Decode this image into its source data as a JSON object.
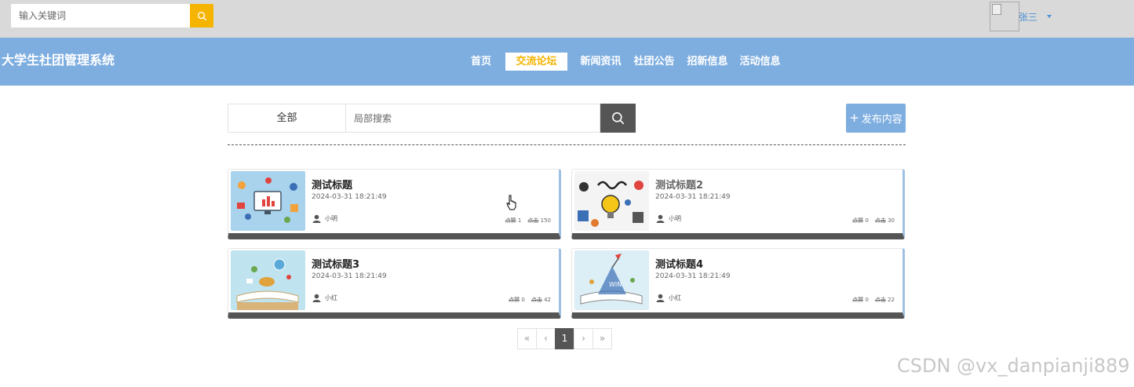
{
  "topbar": {
    "search_placeholder": "输入关键词",
    "username": "张三"
  },
  "navbar": {
    "site_title": "大学生社团管理系统",
    "items": [
      {
        "label": "首页"
      },
      {
        "label": "交流论坛",
        "active": true
      },
      {
        "label": "新闻资讯"
      },
      {
        "label": "社团公告"
      },
      {
        "label": "招新信息"
      },
      {
        "label": "活动信息"
      }
    ]
  },
  "toolbar": {
    "filter_label": "全部",
    "search_placeholder": "局部搜索",
    "publish_label": "发布内容"
  },
  "posts": [
    {
      "title": "测试标题",
      "time": "2024-03-31 18:21:49",
      "author": "小明",
      "likes_label": "点赞",
      "likes": "1",
      "clicks_label": "点击",
      "clicks": "150"
    },
    {
      "title": "测试标题2",
      "time": "2024-03-31 18:21:49",
      "author": "小明",
      "likes_label": "点赞",
      "likes": "0",
      "clicks_label": "点击",
      "clicks": "30"
    },
    {
      "title": "测试标题3",
      "time": "2024-03-31 18:21:49",
      "author": "小红",
      "likes_label": "点赞",
      "likes": "0",
      "clicks_label": "点击",
      "clicks": "42"
    },
    {
      "title": "测试标题4",
      "time": "2024-03-31 18:21:49",
      "author": "小红",
      "likes_label": "点赞",
      "likes": "0",
      "clicks_label": "点击",
      "clicks": "22"
    }
  ],
  "pagination": {
    "first": "«",
    "prev": "‹",
    "current": "1",
    "next": "›",
    "last": "»"
  },
  "watermark": "CSDN @vx_danpianji889",
  "colors": {
    "accent": "#f5b400",
    "nav_bg": "#7eaee0",
    "topbar_bg": "#d9d9d9",
    "dark": "#555555"
  }
}
